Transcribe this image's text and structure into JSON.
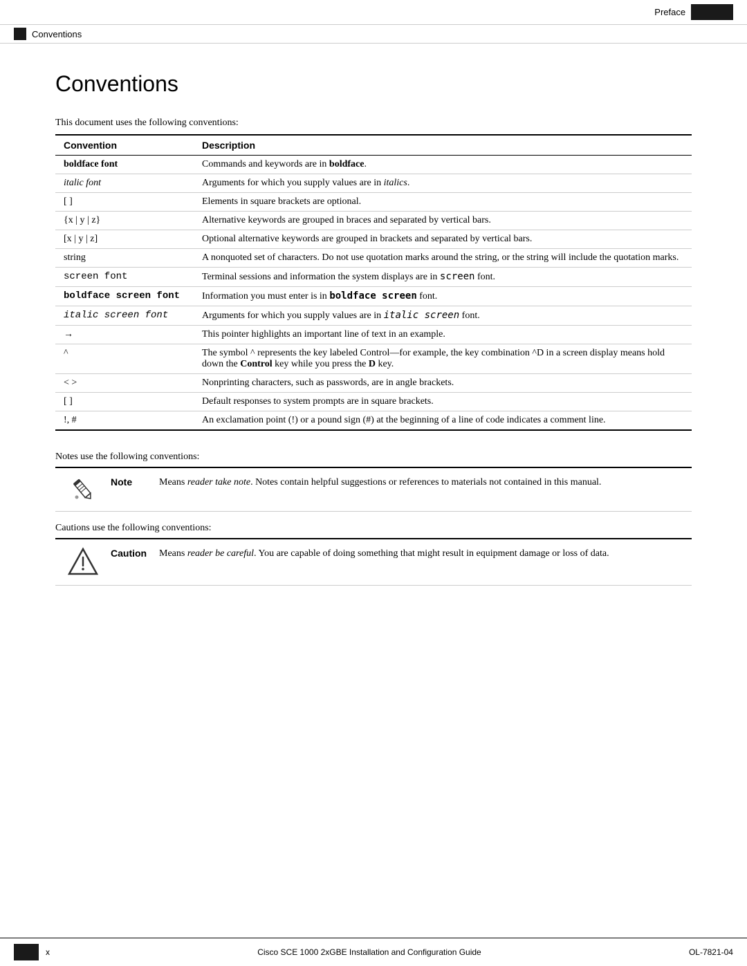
{
  "header": {
    "preface_label": "Preface",
    "tab_label": ""
  },
  "breadcrumb": {
    "text": "Conventions"
  },
  "page_title": "Conventions",
  "intro_text": "This document uses the following conventions:",
  "table": {
    "col1_header": "Convention",
    "col2_header": "Description",
    "rows": [
      {
        "convention": "boldface font",
        "convention_style": "bold",
        "description": "Commands and keywords are in <b>boldface</b>.",
        "description_raw": "Commands and keywords are in boldface."
      },
      {
        "convention": "italic font",
        "convention_style": "italic",
        "description": "Arguments for which you supply values are in <i>italics</i>.",
        "description_raw": "Arguments for which you supply values are in italics."
      },
      {
        "convention": "[ ]",
        "convention_style": "normal",
        "description": "Elements in square brackets are optional.",
        "description_raw": "Elements in square brackets are optional."
      },
      {
        "convention": "{x | y | z}",
        "convention_style": "normal",
        "description": "Alternative keywords are grouped in braces and separated by vertical bars.",
        "description_raw": "Alternative keywords are grouped in braces and separated by vertical bars."
      },
      {
        "convention": "[x | y | z]",
        "convention_style": "normal",
        "description": "Optional alternative keywords are grouped in brackets and separated by vertical bars.",
        "description_raw": "Optional alternative keywords are grouped in brackets and separated by vertical bars."
      },
      {
        "convention": "string",
        "convention_style": "normal",
        "description": "A nonquoted set of characters. Do not use quotation marks around the string, or the string will include the quotation marks.",
        "description_raw": "A nonquoted set of characters. Do not use quotation marks around the string, or the string will include the quotation marks."
      },
      {
        "convention": "screen font",
        "convention_style": "mono",
        "description": "Terminal sessions and information the system displays are in <code>screen</code> font.",
        "description_raw": "Terminal sessions and information the system displays are in screen font."
      },
      {
        "convention": "boldface screen font",
        "convention_style": "mono-bold",
        "description": "Information you must enter is in <b><code>boldface screen</code></b> font.",
        "description_raw": "Information you must enter is in boldface screen font."
      },
      {
        "convention": "italic screen font",
        "convention_style": "mono-italic",
        "description": "Arguments for which you supply values are in <i><code>italic screen</code></i> font.",
        "description_raw": "Arguments for which you supply values are in italic screen font."
      },
      {
        "convention": "→",
        "convention_style": "normal",
        "description": "This pointer highlights an important line of text in an example.",
        "description_raw": "This pointer highlights an important line of text in an example."
      },
      {
        "convention": "^",
        "convention_style": "normal",
        "description": "The symbol ^ represents the key labeled Control—for example, the key combination ^D in a screen display means hold down the <b>Control</b> key while you press the <b>D</b> key.",
        "description_raw": "The symbol ^ represents the key labeled Control—for example, the key combination ^D in a screen display means hold down the Control key while you press the D key."
      },
      {
        "convention": "< >",
        "convention_style": "normal",
        "description": "Nonprinting characters, such as passwords, are in angle brackets.",
        "description_raw": "Nonprinting characters, such as passwords, are in angle brackets."
      },
      {
        "convention": "[ ]",
        "convention_style": "normal",
        "description": "Default responses to system prompts are in square brackets.",
        "description_raw": "Default responses to system prompts are in square brackets."
      },
      {
        "convention": "!, #",
        "convention_style": "normal",
        "description": "An exclamation point (!) or a pound sign (#) at the beginning of a line of code indicates a comment line.",
        "description_raw": "An exclamation point (!) or a pound sign (#) at the beginning of a line of code indicates a comment line."
      }
    ]
  },
  "notes_section": {
    "intro": "Notes use the following conventions:",
    "note_label": "Note",
    "note_text": "Means reader take note. Notes contain helpful suggestions or references to materials not contained in this manual."
  },
  "cautions_section": {
    "intro": "Cautions use the following conventions:",
    "caution_label": "Caution",
    "caution_text": "Means reader be careful. You are capable of doing something that might result in equipment damage or loss of data."
  },
  "footer": {
    "page_number": "x",
    "document_title": "Cisco SCE 1000 2xGBE Installation and Configuration Guide",
    "doc_number": "OL-7821-04"
  }
}
